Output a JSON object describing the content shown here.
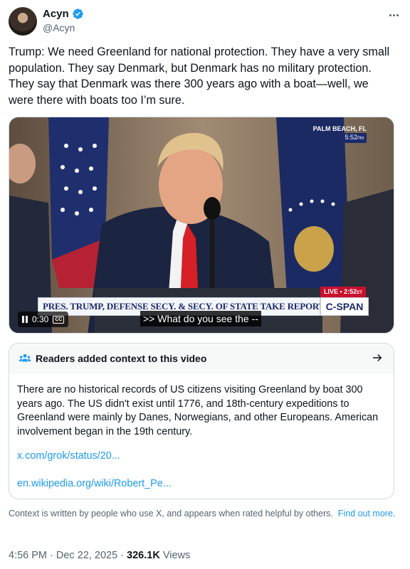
{
  "author": {
    "display_name": "Acyn",
    "handle": "@Acyn"
  },
  "tweet": {
    "text": "Trump: We need Greenland for national protection. They have a very small population. They say Denmark, but Denmark has no military protection. They say that Denmark was there 300 years ago with a boat—well, we were there with boats too I’m sure."
  },
  "video": {
    "location": "PALM BEACH, FL",
    "location_time": "5:52",
    "location_time_suffix": "PM",
    "chyron": "PRES. TRUMP, DEFENSE SECY. & SECY. OF STATE TAKE REPORTER QUESTIONS",
    "network": "C-SPAN",
    "live_label": "LIVE",
    "live_time": "2:52",
    "live_time_suffix": "ET",
    "elapsed": "0:30",
    "cc_label": "CC",
    "caption": ">> What do you see the --"
  },
  "community_note": {
    "title": "Readers added context to this video",
    "body": "There are no historical records of US citizens visiting Greenland by boat 300 years ago. The US didn't exist until 1776, and 18th-century expeditions to Greenland were mainly by Danes, Norwegians, and other Europeans. American involvement began in the 19th century.",
    "links": [
      "x.com/grok/status/20...",
      "en.wikipedia.org/wiki/Robert_Pe..."
    ]
  },
  "footer": {
    "disclaimer": "Context is written by people who use X, and appears when rated helpful by others.",
    "find_out_more": "Find out more."
  },
  "meta": {
    "time": "4:56 PM",
    "date": "Dec 22, 2025",
    "views_count": "326.1K",
    "views_label": "Views"
  },
  "colors": {
    "accent": "#1d9bf0",
    "text": "#0f1419",
    "secondary": "#536471",
    "cspan_blue": "#1b2a6b",
    "tie_red": "#d61f26"
  },
  "icons": {
    "verified": "verified-badge-icon",
    "more": "more-options-icon",
    "people": "people-icon",
    "arrow": "arrow-right-icon",
    "pause": "pause-icon"
  }
}
